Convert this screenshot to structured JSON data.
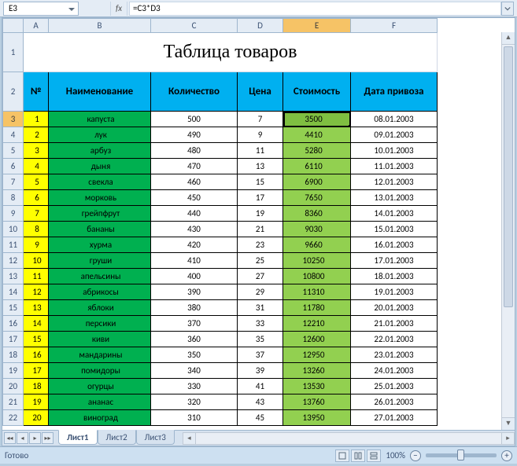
{
  "formula_bar": {
    "cell_ref": "E3",
    "fx_label": "fx",
    "formula": "=C3*D3"
  },
  "columns": {
    "letters": [
      "A",
      "B",
      "C",
      "D",
      "E",
      "F"
    ],
    "widths": [
      32,
      130,
      110,
      58,
      86,
      110
    ],
    "active": "E"
  },
  "title": "Таблица товаров",
  "headers": {
    "num": "№",
    "name": "Наименование",
    "qty": "Количество",
    "price": "Цена",
    "cost": "Стоимость",
    "date": "Дата привоза"
  },
  "active_cell_row": 3,
  "rows": [
    {
      "num": "1",
      "name": "капуста",
      "qty": 500,
      "price": 7,
      "cost": 3500,
      "date": "08.01.2003"
    },
    {
      "num": "2",
      "name": "лук",
      "qty": 490,
      "price": 9,
      "cost": 4410,
      "date": "09.01.2003"
    },
    {
      "num": "3",
      "name": "арбуз",
      "qty": 480,
      "price": 11,
      "cost": 5280,
      "date": "10.01.2003"
    },
    {
      "num": "4",
      "name": "дыня",
      "qty": 470,
      "price": 13,
      "cost": 6110,
      "date": "11.01.2003"
    },
    {
      "num": "5",
      "name": "свекла",
      "qty": 460,
      "price": 15,
      "cost": 6900,
      "date": "12.01.2003"
    },
    {
      "num": "6",
      "name": "морковь",
      "qty": 450,
      "price": 17,
      "cost": 7650,
      "date": "13.01.2003"
    },
    {
      "num": "7",
      "name": "грейпфрут",
      "qty": 440,
      "price": 19,
      "cost": 8360,
      "date": "14.01.2003"
    },
    {
      "num": "8",
      "name": "бананы",
      "qty": 430,
      "price": 21,
      "cost": 9030,
      "date": "15.01.2003"
    },
    {
      "num": "9",
      "name": "хурма",
      "qty": 420,
      "price": 23,
      "cost": 9660,
      "date": "16.01.2003"
    },
    {
      "num": "10",
      "name": "груши",
      "qty": 410,
      "price": 25,
      "cost": 10250,
      "date": "17.01.2003"
    },
    {
      "num": "11",
      "name": "апельсины",
      "qty": 400,
      "price": 27,
      "cost": 10800,
      "date": "18.01.2003"
    },
    {
      "num": "12",
      "name": "абрикосы",
      "qty": 390,
      "price": 29,
      "cost": 11310,
      "date": "19.01.2003"
    },
    {
      "num": "13",
      "name": "яблоки",
      "qty": 380,
      "price": 31,
      "cost": 11780,
      "date": "20.01.2003"
    },
    {
      "num": "14",
      "name": "персики",
      "qty": 370,
      "price": 33,
      "cost": 12210,
      "date": "21.01.2003"
    },
    {
      "num": "15",
      "name": "киви",
      "qty": 360,
      "price": 35,
      "cost": 12600,
      "date": "22.01.2003"
    },
    {
      "num": "16",
      "name": "мандарины",
      "qty": 350,
      "price": 37,
      "cost": 12950,
      "date": "23.01.2003"
    },
    {
      "num": "17",
      "name": "помидоры",
      "qty": 340,
      "price": 39,
      "cost": 13260,
      "date": "24.01.2003"
    },
    {
      "num": "18",
      "name": "огурцы",
      "qty": 330,
      "price": 41,
      "cost": 13530,
      "date": "25.01.2003"
    },
    {
      "num": "19",
      "name": "ананас",
      "qty": 320,
      "price": 43,
      "cost": 13760,
      "date": "26.01.2003"
    },
    {
      "num": "20",
      "name": "виноград",
      "qty": 310,
      "price": 45,
      "cost": 13950,
      "date": "27.01.2003"
    }
  ],
  "sheet_tabs": [
    "Лист1",
    "Лист2",
    "Лист3"
  ],
  "status": {
    "ready": "Готово",
    "zoom": "100%"
  }
}
